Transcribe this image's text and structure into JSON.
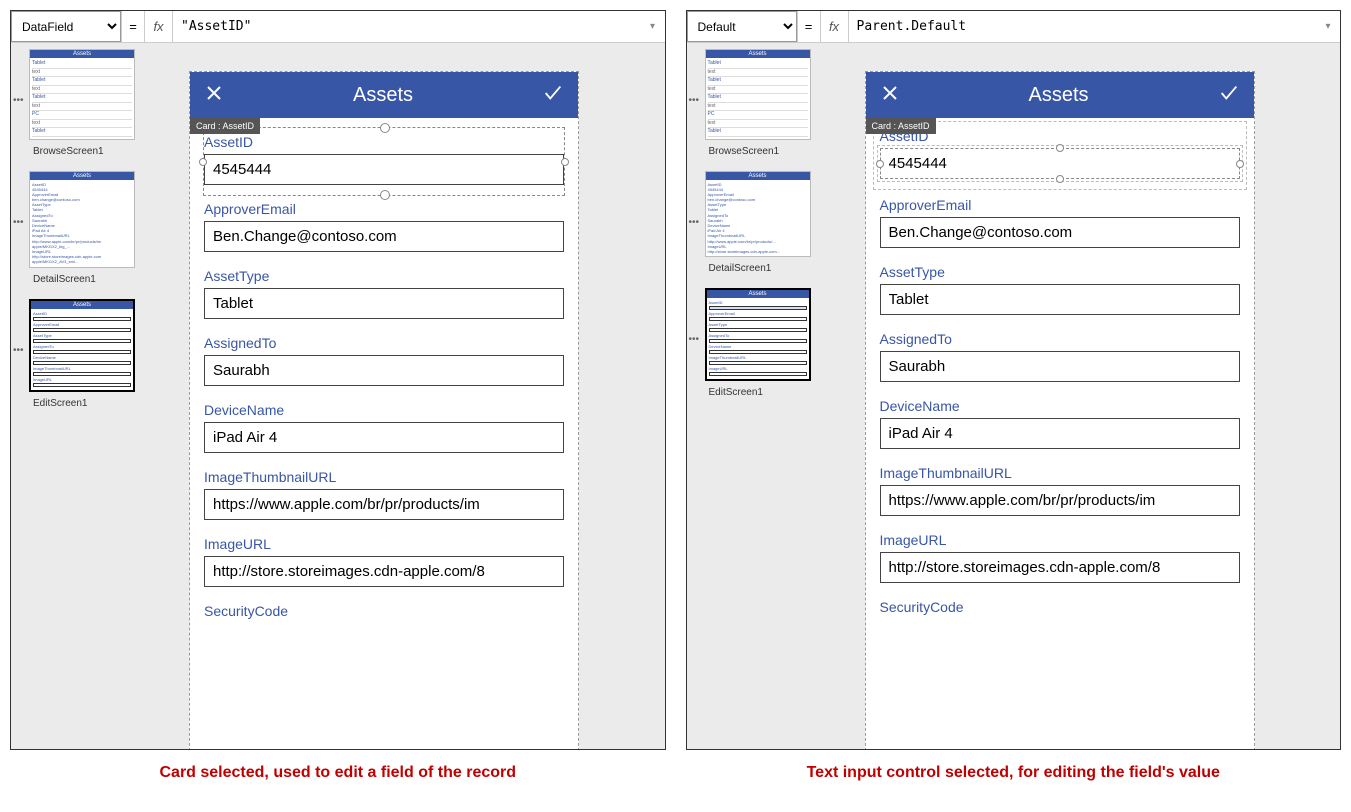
{
  "left": {
    "property": "DataField",
    "formula": "\"AssetID\"",
    "card_tag": "Card : AssetID",
    "selection": "card"
  },
  "right": {
    "property": "Default",
    "formula": "Parent.Default",
    "card_tag": "Card : AssetID",
    "selection": "input"
  },
  "phone_title": "Assets",
  "thumbs": {
    "header": "Assets",
    "browse_label": "BrowseScreen1",
    "detail_label": "DetailScreen1",
    "edit_label": "EditScreen1"
  },
  "fields": [
    {
      "label": "AssetID",
      "value": "4545444"
    },
    {
      "label": "ApproverEmail",
      "value": "Ben.Change@contoso.com"
    },
    {
      "label": "AssetType",
      "value": "Tablet"
    },
    {
      "label": "AssignedTo",
      "value": "Saurabh"
    },
    {
      "label": "DeviceName",
      "value": "iPad Air 4"
    },
    {
      "label": "ImageThumbnailURL",
      "value": "https://www.apple.com/br/pr/products/im"
    },
    {
      "label": "ImageURL",
      "value": "http://store.storeimages.cdn-apple.com/8"
    },
    {
      "label": "SecurityCode",
      "value": ""
    }
  ],
  "captions": {
    "left": "Card selected, used to edit a field of the record",
    "right": "Text input control selected, for editing the field's value"
  },
  "icons": {
    "eq": "=",
    "fx": "fx",
    "dd": "▾"
  }
}
